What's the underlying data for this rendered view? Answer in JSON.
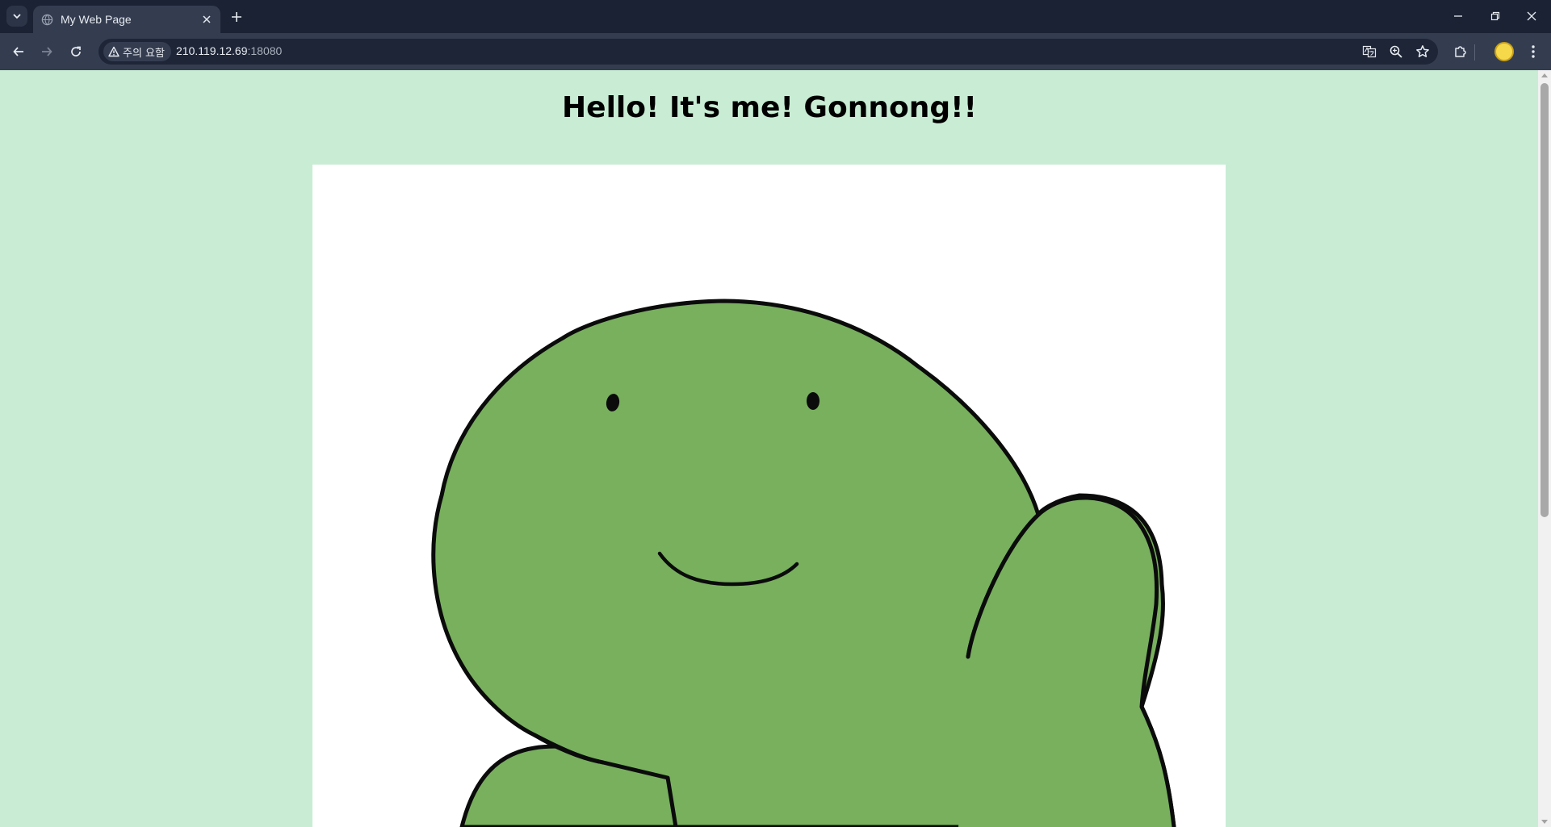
{
  "browser": {
    "tab": {
      "title": "My Web Page",
      "favicon": "globe-icon"
    },
    "address_bar": {
      "security_label": "주의 요함",
      "url_host": "210.119.12.69",
      "url_port": ":18080"
    },
    "icons": {
      "tab_search": "chevron-down-icon",
      "tab_close": "close-icon",
      "new_tab": "plus-icon",
      "back": "arrow-left-icon",
      "forward": "arrow-right-icon",
      "reload": "reload-icon",
      "warning": "warning-icon",
      "translate": "translate-icon",
      "zoom": "zoom-icon",
      "bookmark": "star-icon",
      "extensions": "puzzle-icon",
      "profile": "avatar",
      "menu": "kebab-menu-icon",
      "minimize": "minimize-icon",
      "restore": "restore-icon",
      "close_window": "close-icon"
    }
  },
  "page": {
    "heading": "Hello! It's me! Gonnong!!",
    "image": {
      "subject": "green-character-illustration",
      "body_color": "#78b05e",
      "outline_color": "#0b0b0b"
    },
    "background_color": "#c8edd4"
  }
}
